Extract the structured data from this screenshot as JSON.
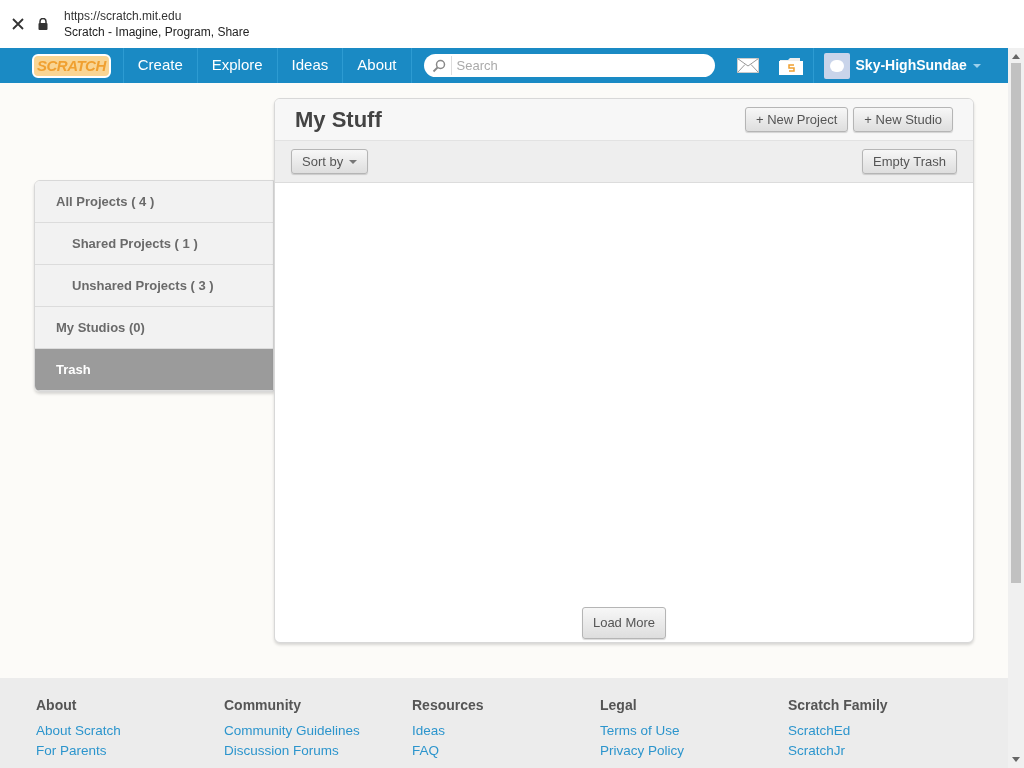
{
  "browser": {
    "url": "https://scratch.mit.edu",
    "title": "Scratch - Imagine, Program, Share"
  },
  "nav": {
    "logo": "SCRATCH",
    "links": [
      "Create",
      "Explore",
      "Ideas",
      "About"
    ],
    "search": {
      "placeholder": "Search"
    },
    "user": "Sky-HighSundae"
  },
  "sidebar": {
    "items": [
      {
        "label": "All Projects ( 4 )",
        "selected": false,
        "children": [
          {
            "label": "Shared Projects ( 1 )",
            "selected": false
          },
          {
            "label": "Unshared Projects ( 3 )",
            "selected": false
          }
        ]
      },
      {
        "label": "My Studios (0)",
        "selected": false
      },
      {
        "label": "Trash",
        "selected": true
      }
    ]
  },
  "panel": {
    "title": "My Stuff",
    "header_buttons": [
      "+ New Project",
      "+ New Studio"
    ],
    "sort": "Sort by",
    "toolbar_button": "Empty Trash",
    "load_more": "Load More"
  },
  "footer": {
    "columns": [
      {
        "heading": "About",
        "links": [
          "About Scratch",
          "For Parents"
        ]
      },
      {
        "heading": "Community",
        "links": [
          "Community Guidelines",
          "Discussion Forums"
        ]
      },
      {
        "heading": "Resources",
        "links": [
          "Ideas",
          "FAQ"
        ]
      },
      {
        "heading": "Legal",
        "links": [
          "Terms of Use",
          "Privacy Policy"
        ]
      },
      {
        "heading": "Scratch Family",
        "links": [
          "ScratchEd",
          "ScratchJr"
        ]
      }
    ]
  }
}
